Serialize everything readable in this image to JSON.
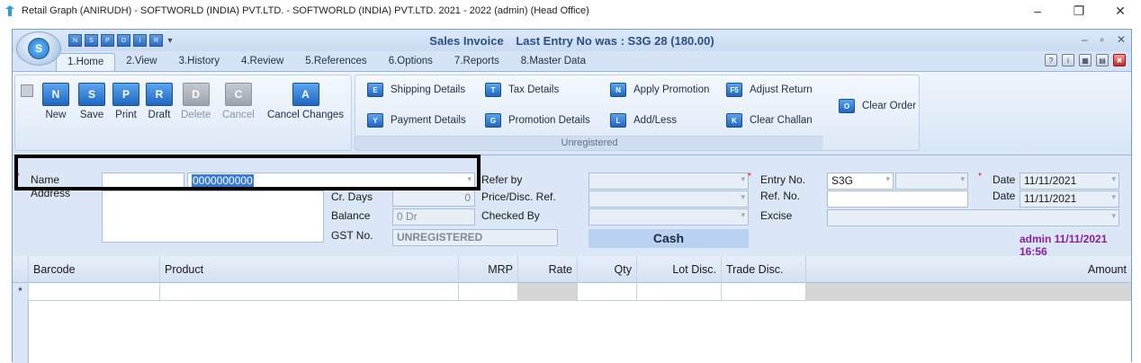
{
  "os_window": {
    "title": "Retail Graph (ANIRUDH) - SOFTWORLD (INDIA) PVT.LTD. - SOFTWORLD (INDIA) PVT.LTD.  2021 - 2022 (admin) (Head Office)",
    "minimize": "–",
    "maximize": "❐",
    "close": "✕"
  },
  "app": {
    "orb_label": "S",
    "title": "Sales Invoice",
    "last_entry": "Last Entry No was : S3G 28  (180.00)",
    "controls": {
      "min": "–",
      "restore": "▫",
      "close": "✕"
    },
    "qat_icons": [
      "N",
      "S",
      "P",
      "D",
      "I",
      "R",
      "▾"
    ]
  },
  "tabs": [
    "1.Home",
    "2.View",
    "3.History",
    "4.Review",
    "5.References",
    "6.Options",
    "7.Reports",
    "8.Master Data"
  ],
  "ribbon": {
    "main_buttons": [
      {
        "label": "New",
        "icon": "N"
      },
      {
        "label": "Save",
        "icon": "S"
      },
      {
        "label": "Print",
        "icon": "P"
      },
      {
        "label": "Draft",
        "icon": "R"
      },
      {
        "label": "Delete",
        "icon": "D"
      },
      {
        "label": "Cancel",
        "icon": "C"
      },
      {
        "label": "Cancel Changes",
        "icon": "A"
      }
    ],
    "options": [
      {
        "label": "Shipping Details",
        "icon": "E"
      },
      {
        "label": "Tax Details",
        "icon": "T"
      },
      {
        "label": "Apply Promotion",
        "icon": "N"
      },
      {
        "label": "Adjust Return",
        "icon": "F5"
      },
      {
        "label": "Payment Details",
        "icon": "Y"
      },
      {
        "label": "Promotion Details",
        "icon": "G"
      },
      {
        "label": "Add/Less",
        "icon": "L"
      },
      {
        "label": "Clear Challan",
        "icon": "K"
      }
    ],
    "group_label": "Unregistered",
    "clear_order": {
      "label": "Clear Order",
      "icon": "O"
    }
  },
  "form": {
    "name_label": "Name",
    "name_value": "",
    "mobile_value": "0000000000",
    "address_label": "Address",
    "cr_days_label": "Cr. Days",
    "cr_days_value": "0",
    "balance_label": "Balance",
    "balance_value": "0 Dr",
    "gst_label": "GST No.",
    "gst_value": "UNREGISTERED",
    "refer_by_label": "Refer by",
    "price_disc_label": "Price/Disc. Ref.",
    "checked_by_label": "Checked By",
    "payment_mode": "Cash",
    "entry_no_label": "Entry No.",
    "entry_prefix": "S3G",
    "ref_no_label": "Ref. No.",
    "excise_label": "Excise",
    "date_label": "Date",
    "date_value": "11/11/2021",
    "ref_date_label": "Date",
    "ref_date_value": "11/11/2021",
    "user_stamp": "admin 11/11/2021 16:56",
    "required_mark": "*"
  },
  "grid": {
    "columns": [
      "Barcode",
      "Product",
      "MRP",
      "Rate",
      "Qty",
      "Lot Disc.",
      "Trade Disc.",
      "Amount"
    ],
    "new_row_marker": "*"
  }
}
